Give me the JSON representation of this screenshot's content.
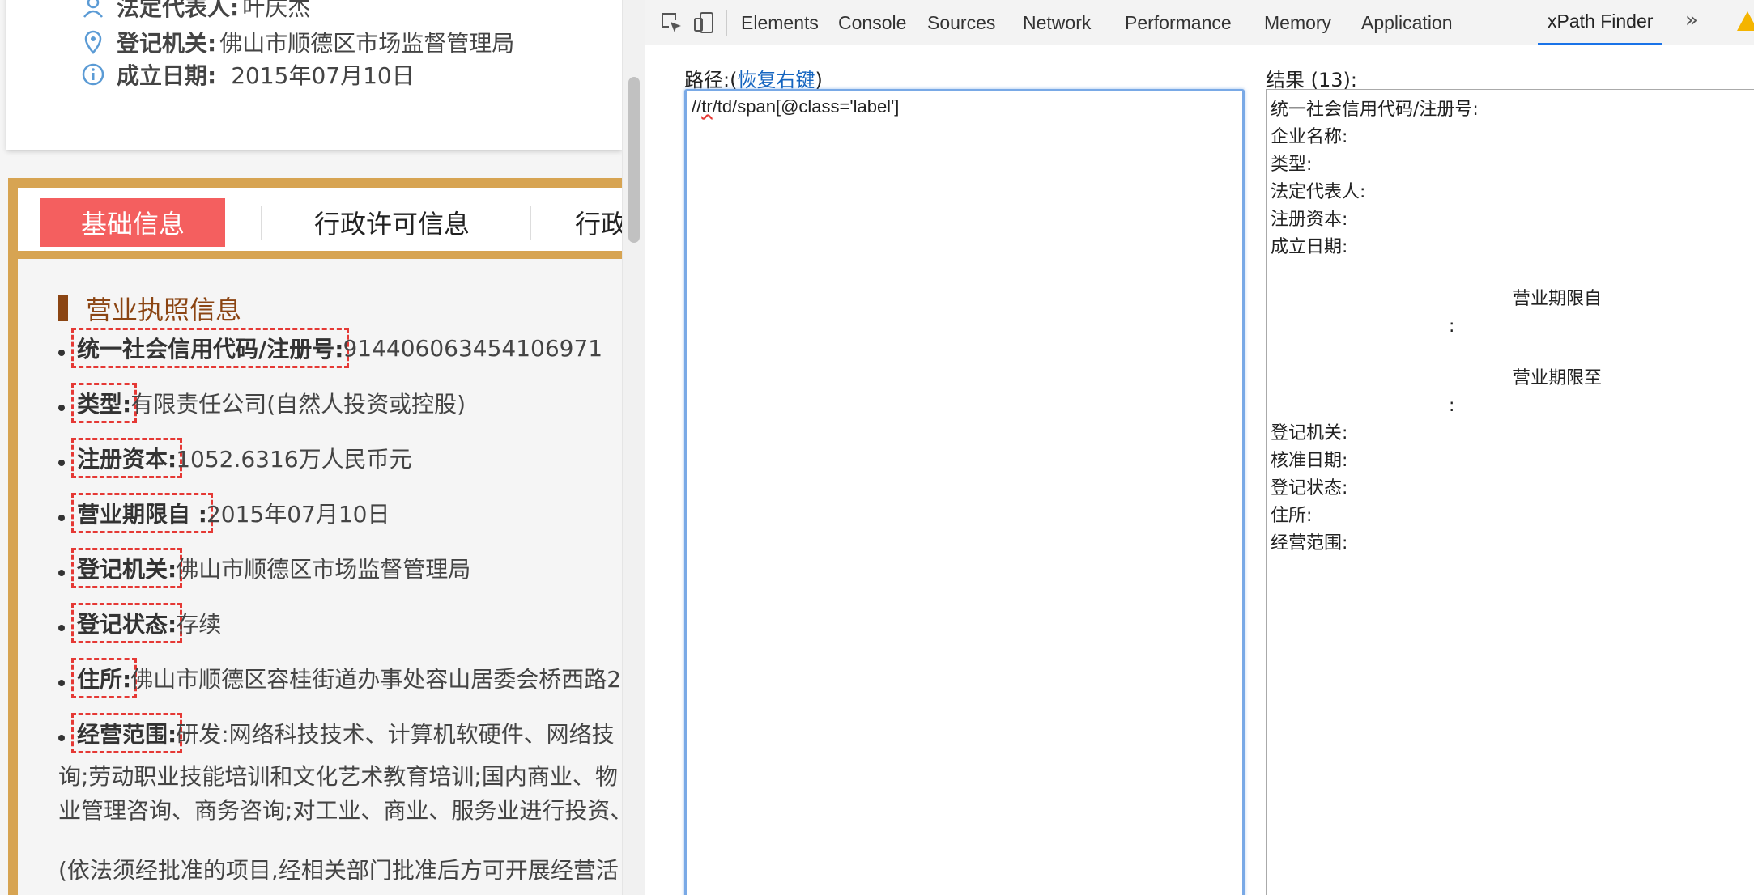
{
  "page": {
    "info_rows": [
      {
        "icon": "person-icon",
        "label": "法定代表人:",
        "value": "叶庆杰"
      },
      {
        "icon": "location-pin-icon",
        "label": "登记机关:",
        "value": "佛山市顺德区市场监督管理局"
      },
      {
        "icon": "info-icon",
        "label": "成立日期:",
        "value": "2015年07月10日"
      }
    ],
    "tabs": {
      "active": "基础信息",
      "second": "行政许可信息",
      "third": "行政处罚信息"
    },
    "section_title": "营业执照信息",
    "fields": [
      {
        "label": "统一社会信用代码/注册号:",
        "value": "914406063454106971"
      },
      {
        "label": "类型:",
        "value": "有限责任公司(自然人投资或控股)"
      },
      {
        "label": "注册资本:",
        "value": "1052.6316万人民币元"
      },
      {
        "label": "营业期限自 :",
        "value": "2015年07月10日"
      },
      {
        "label": "登记机关:",
        "value": "佛山市顺德区市场监督管理局"
      },
      {
        "label": "登记状态:",
        "value": "存续"
      },
      {
        "label": "住所:",
        "value": "佛山市顺德区容桂街道办事处容山居委会桥西路2"
      },
      {
        "label": "经营范围:",
        "value": "研发:网络科技技术、计算机软硬件、网络技"
      }
    ],
    "scope_lines": [
      "询;劳动职业技能培训和文化艺术教育培训;国内商业、物",
      "业管理咨询、商务咨询;对工业、商业、服务业进行投资、"
    ],
    "scope_note": "(依法须经批准的项目,经相关部门批准后方可开展经营活"
  },
  "devtools": {
    "tabs": [
      "Elements",
      "Console",
      "Sources",
      "Network",
      "Performance",
      "Memory",
      "Application",
      "xPath Finder"
    ],
    "active_tab": "xPath Finder",
    "more": "»",
    "path_label_prefix": "路径:(",
    "path_label_link": "恢复右键",
    "path_label_suffix": ")",
    "xpath_prefix": "//",
    "xpath_misspelled": "tr",
    "xpath_rest": "/td/span[@class='label']",
    "result_label": "结果 (13):",
    "results_top": [
      "统一社会信用代码/注册号:",
      "企业名称:",
      "类型:",
      "法定代表人:",
      "注册资本:",
      "成立日期:"
    ],
    "results_mid": [
      {
        "text": "营业期限自",
        "colon": ":"
      },
      {
        "text": "营业期限至",
        "colon": ":"
      }
    ],
    "results_bottom": [
      "登记机关:",
      "核准日期:",
      "登记状态:",
      "住所:",
      "经营范围:"
    ]
  },
  "colors": {
    "accent_tab": "#f45f5f",
    "panel_border": "#d7a452",
    "section_title": "#8b4513",
    "label_dash": "#e53935",
    "devtools_active": "#1a73e8",
    "link": "#1565c0"
  }
}
